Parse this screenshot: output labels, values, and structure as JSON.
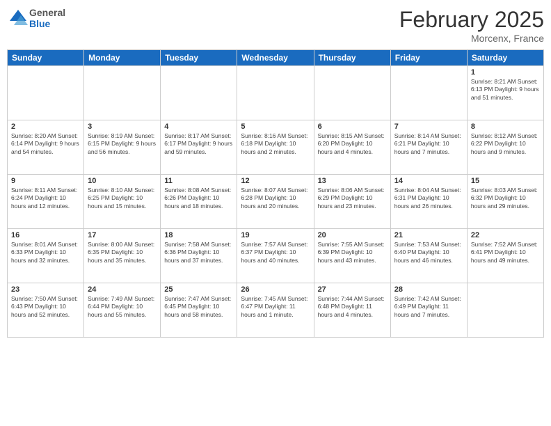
{
  "header": {
    "logo_general": "General",
    "logo_blue": "Blue",
    "month_title": "February 2025",
    "location": "Morcenx, France"
  },
  "weekdays": [
    "Sunday",
    "Monday",
    "Tuesday",
    "Wednesday",
    "Thursday",
    "Friday",
    "Saturday"
  ],
  "weeks": [
    [
      {
        "day": "",
        "info": ""
      },
      {
        "day": "",
        "info": ""
      },
      {
        "day": "",
        "info": ""
      },
      {
        "day": "",
        "info": ""
      },
      {
        "day": "",
        "info": ""
      },
      {
        "day": "",
        "info": ""
      },
      {
        "day": "1",
        "info": "Sunrise: 8:21 AM\nSunset: 6:13 PM\nDaylight: 9 hours\nand 51 minutes."
      }
    ],
    [
      {
        "day": "2",
        "info": "Sunrise: 8:20 AM\nSunset: 6:14 PM\nDaylight: 9 hours\nand 54 minutes."
      },
      {
        "day": "3",
        "info": "Sunrise: 8:19 AM\nSunset: 6:15 PM\nDaylight: 9 hours\nand 56 minutes."
      },
      {
        "day": "4",
        "info": "Sunrise: 8:17 AM\nSunset: 6:17 PM\nDaylight: 9 hours\nand 59 minutes."
      },
      {
        "day": "5",
        "info": "Sunrise: 8:16 AM\nSunset: 6:18 PM\nDaylight: 10 hours\nand 2 minutes."
      },
      {
        "day": "6",
        "info": "Sunrise: 8:15 AM\nSunset: 6:20 PM\nDaylight: 10 hours\nand 4 minutes."
      },
      {
        "day": "7",
        "info": "Sunrise: 8:14 AM\nSunset: 6:21 PM\nDaylight: 10 hours\nand 7 minutes."
      },
      {
        "day": "8",
        "info": "Sunrise: 8:12 AM\nSunset: 6:22 PM\nDaylight: 10 hours\nand 9 minutes."
      }
    ],
    [
      {
        "day": "9",
        "info": "Sunrise: 8:11 AM\nSunset: 6:24 PM\nDaylight: 10 hours\nand 12 minutes."
      },
      {
        "day": "10",
        "info": "Sunrise: 8:10 AM\nSunset: 6:25 PM\nDaylight: 10 hours\nand 15 minutes."
      },
      {
        "day": "11",
        "info": "Sunrise: 8:08 AM\nSunset: 6:26 PM\nDaylight: 10 hours\nand 18 minutes."
      },
      {
        "day": "12",
        "info": "Sunrise: 8:07 AM\nSunset: 6:28 PM\nDaylight: 10 hours\nand 20 minutes."
      },
      {
        "day": "13",
        "info": "Sunrise: 8:06 AM\nSunset: 6:29 PM\nDaylight: 10 hours\nand 23 minutes."
      },
      {
        "day": "14",
        "info": "Sunrise: 8:04 AM\nSunset: 6:31 PM\nDaylight: 10 hours\nand 26 minutes."
      },
      {
        "day": "15",
        "info": "Sunrise: 8:03 AM\nSunset: 6:32 PM\nDaylight: 10 hours\nand 29 minutes."
      }
    ],
    [
      {
        "day": "16",
        "info": "Sunrise: 8:01 AM\nSunset: 6:33 PM\nDaylight: 10 hours\nand 32 minutes."
      },
      {
        "day": "17",
        "info": "Sunrise: 8:00 AM\nSunset: 6:35 PM\nDaylight: 10 hours\nand 35 minutes."
      },
      {
        "day": "18",
        "info": "Sunrise: 7:58 AM\nSunset: 6:36 PM\nDaylight: 10 hours\nand 37 minutes."
      },
      {
        "day": "19",
        "info": "Sunrise: 7:57 AM\nSunset: 6:37 PM\nDaylight: 10 hours\nand 40 minutes."
      },
      {
        "day": "20",
        "info": "Sunrise: 7:55 AM\nSunset: 6:39 PM\nDaylight: 10 hours\nand 43 minutes."
      },
      {
        "day": "21",
        "info": "Sunrise: 7:53 AM\nSunset: 6:40 PM\nDaylight: 10 hours\nand 46 minutes."
      },
      {
        "day": "22",
        "info": "Sunrise: 7:52 AM\nSunset: 6:41 PM\nDaylight: 10 hours\nand 49 minutes."
      }
    ],
    [
      {
        "day": "23",
        "info": "Sunrise: 7:50 AM\nSunset: 6:43 PM\nDaylight: 10 hours\nand 52 minutes."
      },
      {
        "day": "24",
        "info": "Sunrise: 7:49 AM\nSunset: 6:44 PM\nDaylight: 10 hours\nand 55 minutes."
      },
      {
        "day": "25",
        "info": "Sunrise: 7:47 AM\nSunset: 6:45 PM\nDaylight: 10 hours\nand 58 minutes."
      },
      {
        "day": "26",
        "info": "Sunrise: 7:45 AM\nSunset: 6:47 PM\nDaylight: 11 hours\nand 1 minute."
      },
      {
        "day": "27",
        "info": "Sunrise: 7:44 AM\nSunset: 6:48 PM\nDaylight: 11 hours\nand 4 minutes."
      },
      {
        "day": "28",
        "info": "Sunrise: 7:42 AM\nSunset: 6:49 PM\nDaylight: 11 hours\nand 7 minutes."
      },
      {
        "day": "",
        "info": ""
      }
    ]
  ]
}
